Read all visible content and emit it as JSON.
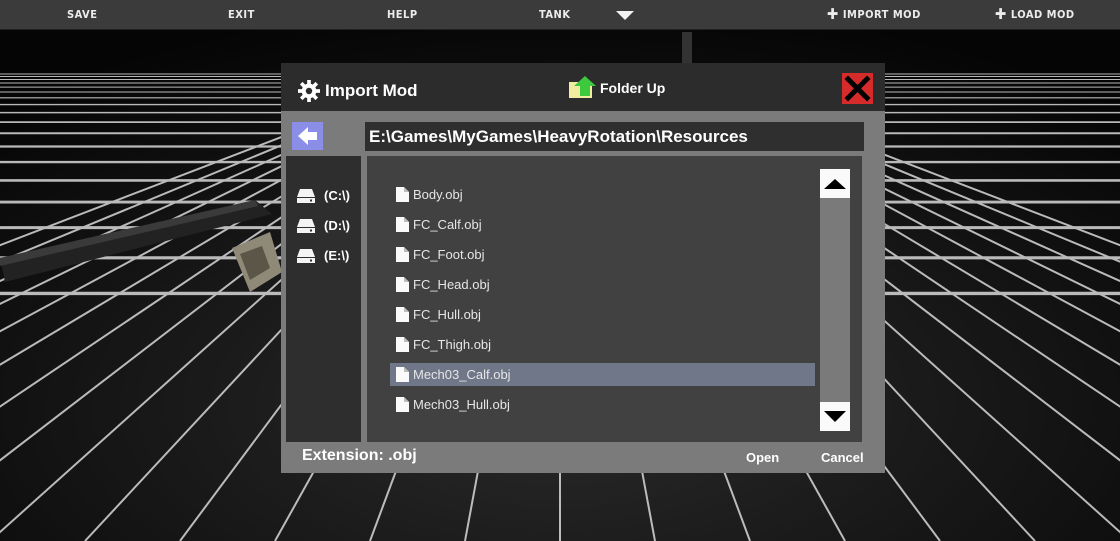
{
  "menu": {
    "save": "SAVE",
    "exit": "EXIT",
    "help": "HELP",
    "vehicle_type": "TANK",
    "import_mod": "IMPORT MOD",
    "load_mod": "LOAD MOD"
  },
  "dialog": {
    "title": "Import Mod",
    "folder_up": "Folder Up",
    "path": "E:\\Games\\MyGames\\HeavyRotation\\Resources",
    "drives": [
      "(C:\\)",
      "(D:\\)",
      "(E:\\)"
    ],
    "files": [
      "Body.obj",
      "FC_Calf.obj",
      "FC_Foot.obj",
      "FC_Head.obj",
      "FC_Hull.obj",
      "FC_Thigh.obj",
      "Mech03_Calf.obj",
      "Mech03_Hull.obj"
    ],
    "selected_file": "Mech03_Calf.obj",
    "extension": "Extension: .obj",
    "open": "Open",
    "cancel": "Cancel"
  },
  "icons": {
    "settings": "gear-icon",
    "folder_up": "folder-up-icon",
    "close": "close-x-icon",
    "back": "back-arrow-icon",
    "drive": "drive-icon",
    "file": "file-icon",
    "scroll_up": "triangle-up-icon",
    "scroll_down": "triangle-down-icon",
    "dropdown": "dropdown-arrow-icon",
    "plus": "plus-icon"
  },
  "colors": {
    "close_button": "#d62b2b",
    "back_button": "#8a8ee6",
    "selected_row": "#6f7788",
    "folder_icon": "#f1eca0",
    "folder_arrow": "#3ec83e"
  }
}
